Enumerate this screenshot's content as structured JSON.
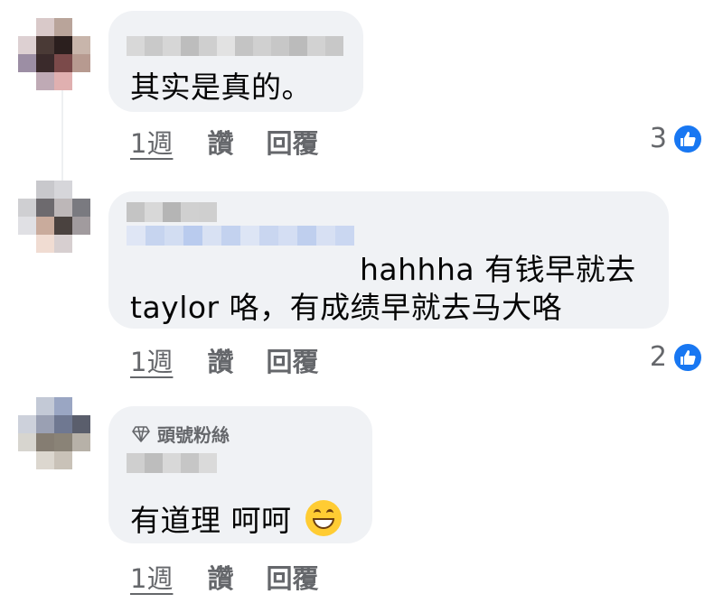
{
  "comments": [
    {
      "text": "其实是真的。",
      "time": "1週",
      "like_label": "讚",
      "reply_label": "回覆",
      "reaction_count": "3"
    },
    {
      "text_line1": "hahhha 有钱早就去",
      "text_line2": "taylor 咯，有成绩早就去马大咯",
      "time": "1週",
      "like_label": "讚",
      "reply_label": "回覆",
      "reaction_count": "2"
    },
    {
      "badge": "頭號粉絲",
      "text": "有道理 呵呵",
      "emoji": "grinning-face-emoji",
      "time": "1週",
      "like_label": "讚",
      "reply_label": "回覆"
    }
  ],
  "colors": {
    "bubble": "#f0f2f5",
    "text": "#050505",
    "meta": "#65676b",
    "like_blue": "#1877f2"
  }
}
